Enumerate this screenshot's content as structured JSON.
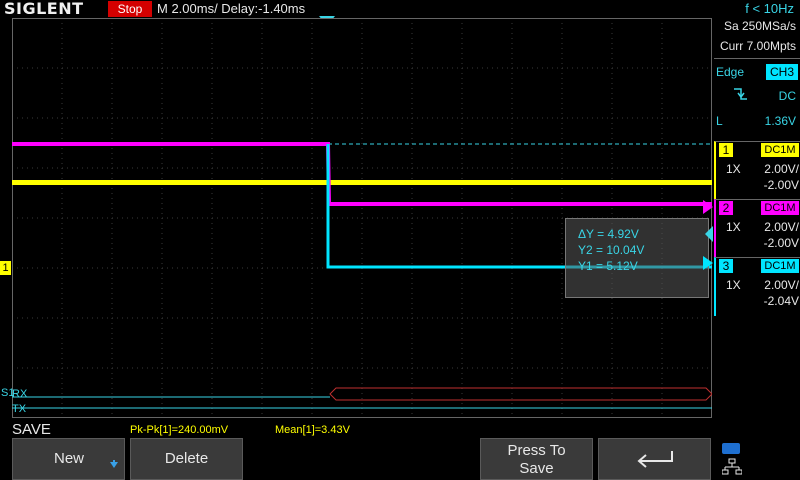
{
  "header": {
    "brand": "SIGLENT",
    "run_state": "Stop",
    "timebase": "M 2.00ms/ Delay:-1.40ms",
    "frequency": "f < 10Hz"
  },
  "acquisition": {
    "sample_rate": "Sa 250MSa/s",
    "memory": "Curr 7.00Mpts"
  },
  "trigger": {
    "type": "Edge",
    "source": "CH3",
    "slope_icon": "falling-edge-icon",
    "coupling": "DC",
    "level_label": "L",
    "level_value": "1.36V"
  },
  "channels": [
    {
      "num": "1",
      "color": "#ffff00",
      "coupling": "DC1M",
      "probe": "1X",
      "vdiv": "2.00V/",
      "offset": "-2.00V"
    },
    {
      "num": "2",
      "color": "#ff00ff",
      "coupling": "DC1M",
      "probe": "1X",
      "vdiv": "2.00V/",
      "offset": "-2.00V"
    },
    {
      "num": "3",
      "color": "#00e5ff",
      "coupling": "DC1M",
      "probe": "1X",
      "vdiv": "2.00V/",
      "offset": "-2.04V"
    }
  ],
  "cursor_readout": {
    "delta_y": "ΔY = 4.92V",
    "y2": "Y2 = 10.04V",
    "y1": "Y1 = 5.12V"
  },
  "decode": {
    "bus_label": "S1",
    "rx_label": "RX",
    "tx_label": "TX"
  },
  "ground_marker": "1",
  "status_bar": {
    "menu_title": "SAVE",
    "measure_pkpk": "Pk-Pk[1]=240.00mV",
    "measure_mean": "Mean[1]=3.43V"
  },
  "softkeys": {
    "new_label": "New",
    "delete_label": "Delete",
    "press_to_save_line1": "Press To",
    "press_to_save_line2": "Save",
    "back_icon": "return-arrow-icon",
    "network_icon": "network-icon"
  }
}
